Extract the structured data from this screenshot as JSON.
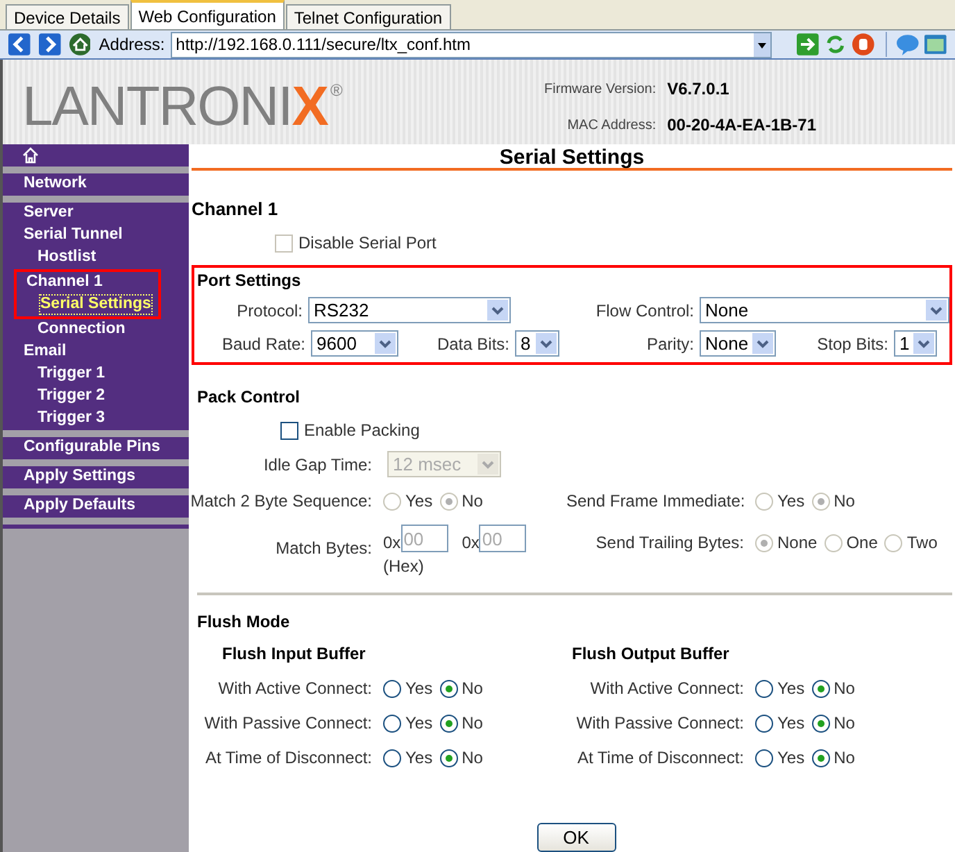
{
  "browser_tabs": [
    {
      "label": "Device Details",
      "selected": false
    },
    {
      "label": "Web Configuration",
      "selected": true
    },
    {
      "label": "Telnet Configuration",
      "selected": false
    }
  ],
  "address_bar": {
    "label": "Address:",
    "url": "http://192.168.0.111/secure/ltx_conf.htm"
  },
  "header": {
    "logo": {
      "text": "LANTRONI",
      "accent": "X",
      "mark": "®"
    },
    "info": [
      {
        "label": "Firmware Version:",
        "value": "V6.7.0.1"
      },
      {
        "label": "MAC Address:",
        "value": "00-20-4A-EA-1B-71"
      }
    ]
  },
  "sidebar": {
    "items": [
      {
        "kind": "home"
      },
      {
        "kind": "section",
        "label": "Network",
        "selected": false,
        "highlighted": false
      },
      {
        "kind": "section",
        "label": "Server",
        "selected": false,
        "highlighted": false
      },
      {
        "kind": "heading",
        "label": "Serial Tunnel",
        "selected": false,
        "highlighted": false
      },
      {
        "kind": "sub",
        "label": "Hostlist",
        "selected": false,
        "highlighted": false
      },
      {
        "kind": "heading",
        "label": "Channel 1",
        "selected": false,
        "highlighted": true
      },
      {
        "kind": "sub",
        "label": "Serial Settings",
        "selected": true,
        "highlighted": true
      },
      {
        "kind": "sub",
        "label": "Connection",
        "selected": false,
        "highlighted": false
      },
      {
        "kind": "heading",
        "label": "Email",
        "selected": false,
        "highlighted": false
      },
      {
        "kind": "sub",
        "label": "Trigger 1",
        "selected": false,
        "highlighted": false
      },
      {
        "kind": "sub",
        "label": "Trigger 2",
        "selected": false,
        "highlighted": false
      },
      {
        "kind": "sub",
        "label": "Trigger 3",
        "selected": false,
        "highlighted": false
      },
      {
        "kind": "section",
        "label": "Configurable Pins",
        "selected": false,
        "highlighted": false
      },
      {
        "kind": "section",
        "label": "Apply Settings",
        "selected": false,
        "highlighted": false
      },
      {
        "kind": "section",
        "label": "Apply Defaults",
        "selected": false,
        "highlighted": false
      }
    ]
  },
  "page_title": "Serial Settings",
  "channel": {
    "title": "Channel 1",
    "disable_serial_port": {
      "label": "Disable Serial Port",
      "checked": false
    }
  },
  "port_settings": {
    "title": "Port Settings",
    "highlighted": true,
    "fields": [
      {
        "label": "Protocol:",
        "value": "RS232"
      },
      {
        "label": "Flow Control:",
        "value": "None"
      },
      {
        "label": "Baud Rate:",
        "value": "9600"
      },
      {
        "label": "Data Bits:",
        "value": "8"
      },
      {
        "label": "Parity:",
        "value": "None"
      },
      {
        "label": "Stop Bits:",
        "value": "1"
      }
    ]
  },
  "pack_control": {
    "title": "Pack Control",
    "enable_packing": {
      "label": "Enable Packing",
      "checked": false
    },
    "idle_gap_time": {
      "label": "Idle Gap Time:",
      "value": "12 msec",
      "disabled": true
    },
    "match_sequence": {
      "label": "Match 2 Byte Sequence:",
      "disabled": true,
      "options": [
        {
          "label": "Yes",
          "selected": false
        },
        {
          "label": "No",
          "selected": true
        }
      ]
    },
    "send_frame_immediate": {
      "label": "Send Frame Immediate:",
      "disabled": true,
      "options": [
        {
          "label": "Yes",
          "selected": false
        },
        {
          "label": "No",
          "selected": true
        }
      ]
    },
    "match_bytes": {
      "label": "Match Bytes:",
      "disabled": true,
      "inputs": [
        {
          "prefix": "0x",
          "placeholder": "00"
        },
        {
          "prefix": "0x",
          "placeholder": "00"
        }
      ],
      "note": "(Hex)"
    },
    "send_trailing_bytes": {
      "label": "Send Trailing Bytes:",
      "disabled": true,
      "options": [
        {
          "label": "None",
          "selected": true
        },
        {
          "label": "One",
          "selected": false
        },
        {
          "label": "Two",
          "selected": false
        }
      ]
    }
  },
  "flush_mode": {
    "title": "Flush Mode",
    "groups": [
      {
        "title": "Flush Input Buffer",
        "rows": [
          {
            "label": "With Active Connect:",
            "options": [
              {
                "label": "Yes",
                "selected": false
              },
              {
                "label": "No",
                "selected": true
              }
            ]
          },
          {
            "label": "With Passive Connect:",
            "options": [
              {
                "label": "Yes",
                "selected": false
              },
              {
                "label": "No",
                "selected": true
              }
            ]
          },
          {
            "label": "At Time of Disconnect:",
            "options": [
              {
                "label": "Yes",
                "selected": false
              },
              {
                "label": "No",
                "selected": true
              }
            ]
          }
        ]
      },
      {
        "title": "Flush Output Buffer",
        "rows": [
          {
            "label": "With Active Connect:",
            "options": [
              {
                "label": "Yes",
                "selected": false
              },
              {
                "label": "No",
                "selected": true
              }
            ]
          },
          {
            "label": "With Passive Connect:",
            "options": [
              {
                "label": "Yes",
                "selected": false
              },
              {
                "label": "No",
                "selected": true
              }
            ]
          },
          {
            "label": "At Time of Disconnect:",
            "options": [
              {
                "label": "Yes",
                "selected": false
              },
              {
                "label": "No",
                "selected": true
              }
            ]
          }
        ]
      }
    ]
  },
  "ok_button": "OK"
}
